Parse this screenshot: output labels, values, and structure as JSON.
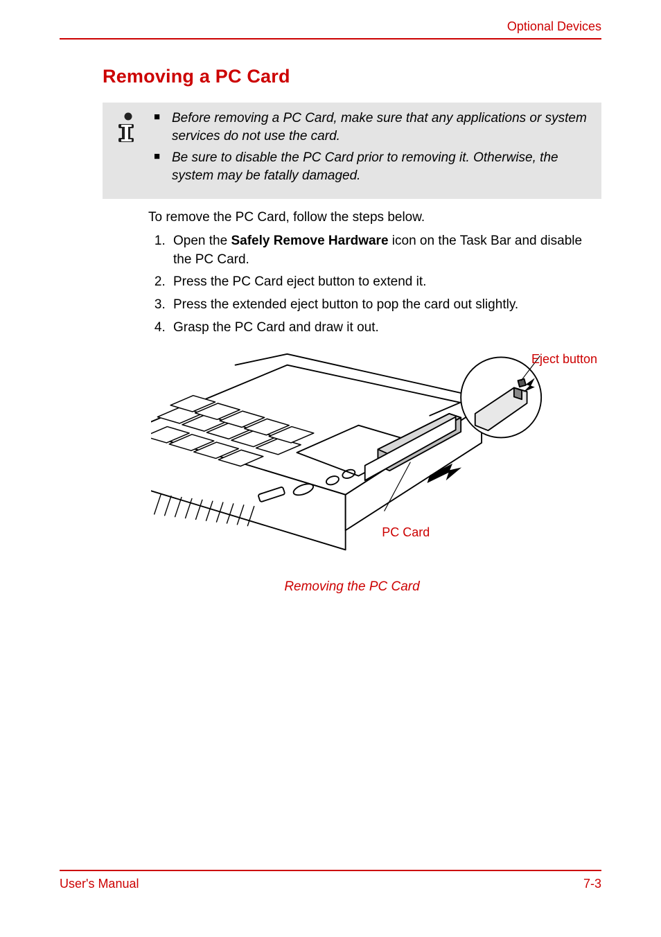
{
  "header": {
    "section": "Optional Devices"
  },
  "title": "Removing a PC Card",
  "info": {
    "items": [
      "Before removing a PC Card, make sure that any applications or system services do not use the card.",
      "Be sure to disable the PC Card prior to removing it. Otherwise, the system may be fatally damaged."
    ]
  },
  "intro": "To remove the PC Card, follow the steps below.",
  "steps": {
    "s1_pre": "Open the ",
    "s1_bold": "Safely Remove Hardware",
    "s1_post": " icon on the Task Bar and disable the PC Card.",
    "s2": "Press the PC Card eject button to extend it.",
    "s3": "Press the extended eject button to pop the card out slightly.",
    "s4": "Grasp the PC Card and draw it out."
  },
  "figure": {
    "eject_label": "Eject button",
    "pccard_label": "PC Card",
    "caption": "Removing the PC Card"
  },
  "footer": {
    "left": "User's Manual",
    "right": "7-3"
  }
}
